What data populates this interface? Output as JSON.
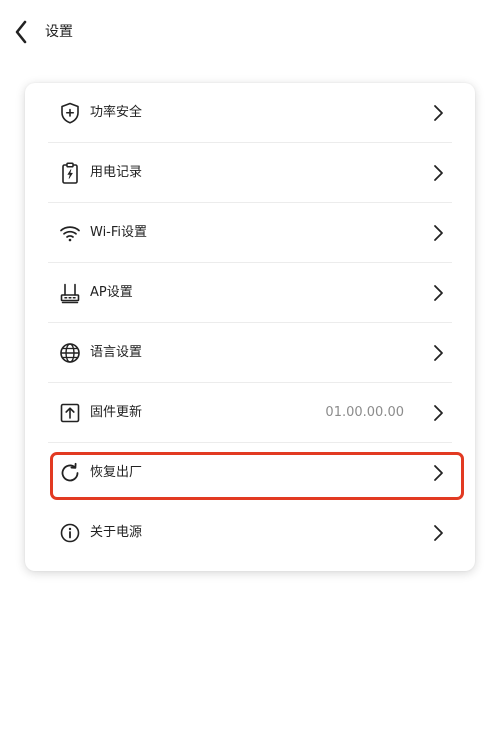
{
  "header": {
    "back_icon": "chevron-left-icon",
    "title": "设置"
  },
  "menu": {
    "items": [
      {
        "id": "power-security",
        "label": "功率安全",
        "icon": "shield-plus-icon",
        "value": ""
      },
      {
        "id": "power-usage-record",
        "label": "用电记录",
        "icon": "clipboard-bolt-icon",
        "value": ""
      },
      {
        "id": "wifi-settings",
        "label": "Wi-Fi设置",
        "icon": "wifi-icon",
        "value": ""
      },
      {
        "id": "ap-settings",
        "label": "AP设置",
        "icon": "router-icon",
        "value": ""
      },
      {
        "id": "language-settings",
        "label": "语言设置",
        "icon": "globe-icon",
        "value": ""
      },
      {
        "id": "firmware-update",
        "label": "固件更新",
        "icon": "upload-box-icon",
        "value": "01.00.00.00"
      },
      {
        "id": "factory-reset",
        "label": "恢复出厂",
        "icon": "refresh-icon",
        "value": ""
      },
      {
        "id": "about-power",
        "label": "关于电源",
        "icon": "info-circle-icon",
        "value": ""
      }
    ],
    "chevron_icon": "chevron-right-icon"
  },
  "colors": {
    "highlight_border": "#e23a22",
    "text_primary": "#222222",
    "text_secondary": "#8c8c8c",
    "divider": "#ececec"
  }
}
